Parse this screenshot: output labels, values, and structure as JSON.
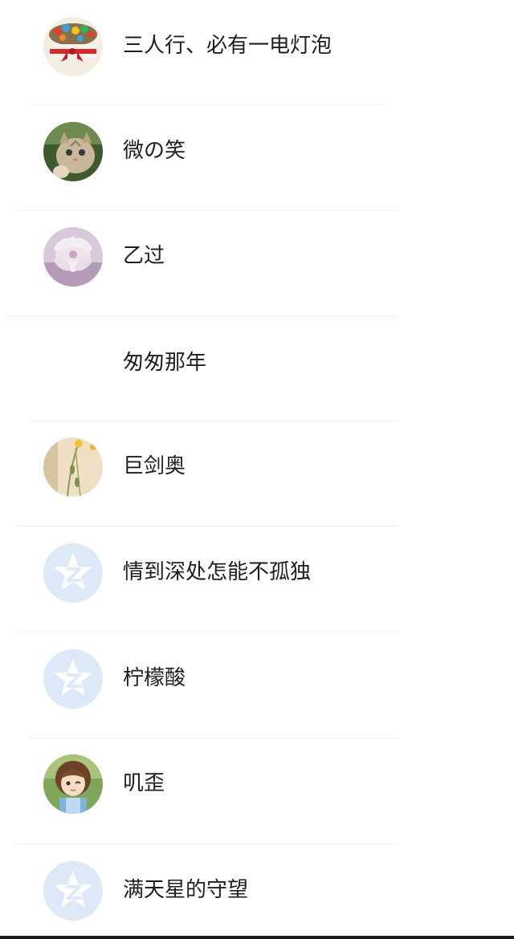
{
  "contacts": [
    {
      "name": "三人行、必有一电灯泡",
      "avatar_icon": "cake-avatar-icon"
    },
    {
      "name": "微の笑",
      "avatar_icon": "kitten-avatar-icon"
    },
    {
      "name": "乙过",
      "avatar_icon": "flower-avatar-icon"
    },
    {
      "name": "匆匆那年",
      "avatar_icon": "no-avatar"
    },
    {
      "name": "巨剑奥",
      "avatar_icon": "plant-avatar-icon"
    },
    {
      "name": "情到深处怎能不孤独",
      "avatar_icon": "qzone-default-avatar-icon"
    },
    {
      "name": "柠檬酸",
      "avatar_icon": "qzone-default-avatar-icon"
    },
    {
      "name": "叽歪",
      "avatar_icon": "anime-girl-avatar-icon"
    },
    {
      "name": "满天星的守望",
      "avatar_icon": "qzone-default-avatar-icon"
    }
  ],
  "colors": {
    "default_avatar_bg": "#dde9f6",
    "divider": "#f1f1f1",
    "text": "#1e1e1e"
  }
}
